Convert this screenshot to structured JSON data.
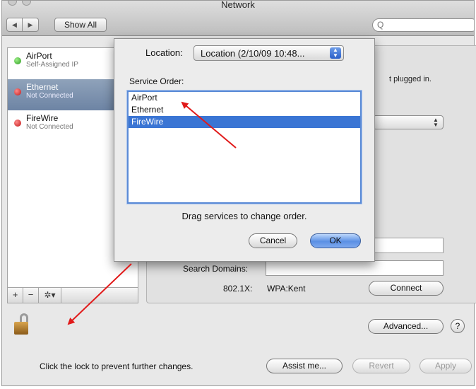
{
  "window": {
    "title": "Network"
  },
  "toolbar": {
    "back_icon": "back-arrow-icon",
    "forward_icon": "forward-arrow-icon",
    "back_glyph": "◀",
    "forward_glyph": "▶",
    "show_all_label": "Show All",
    "search_placeholder": "",
    "search_glyph": "Q"
  },
  "services": [
    {
      "name": "AirPort",
      "status": "Self-Assigned IP",
      "color": "green",
      "selected": false
    },
    {
      "name": "Ethernet",
      "status": "Not Connected",
      "color": "red",
      "selected": true
    },
    {
      "name": "FireWire",
      "status": "Not Connected",
      "color": "red",
      "selected": false
    }
  ],
  "list_footer": {
    "add": "+",
    "remove": "−",
    "gear": "✲▾"
  },
  "panel": {
    "status_fragment": "t plugged in.",
    "search_domains_label": "Search Domains:",
    "auth_label": "802.1X:",
    "auth_value": "WPA:Kent",
    "connect_label": "Connect",
    "advanced_label": "Advanced...",
    "help_label": "?"
  },
  "footer": {
    "lock_text": "Click the lock to prevent further changes.",
    "assist_label": "Assist me...",
    "revert_label": "Revert",
    "apply_label": "Apply"
  },
  "sheet": {
    "location_label": "Location:",
    "location_value": "Location (2/10/09 10:48...",
    "service_order_label": "Service Order:",
    "order": [
      "AirPort",
      "Ethernet",
      "FireWire"
    ],
    "selected_index": 2,
    "hint": "Drag services to change order.",
    "cancel_label": "Cancel",
    "ok_label": "OK"
  },
  "colors": {
    "annotation_arrow": "#e11a1a",
    "selection": "#3a75d4"
  }
}
